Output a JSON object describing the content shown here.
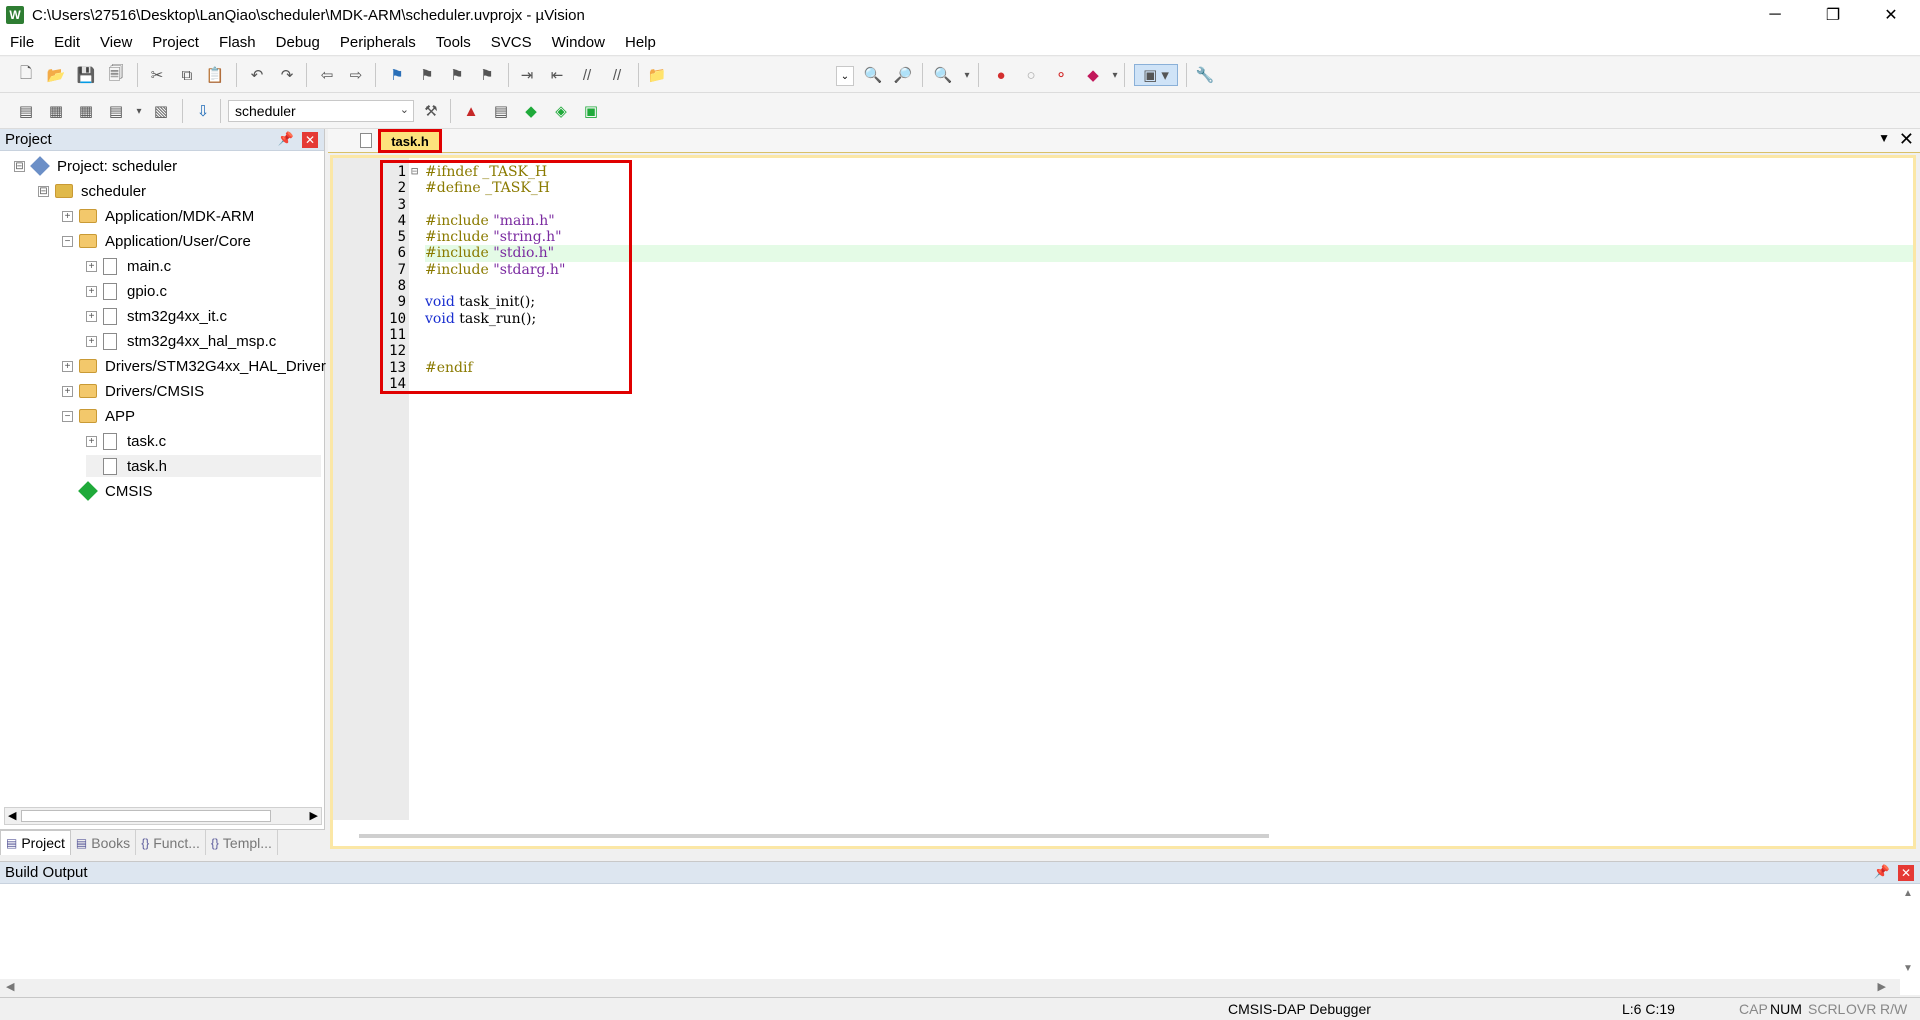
{
  "window": {
    "title": "C:\\Users\\27516\\Desktop\\LanQiao\\scheduler\\MDK-ARM\\scheduler.uvprojx - µVision",
    "app_icon": "W",
    "minimize_glyph": "─",
    "maximize_glyph": "❐",
    "close_glyph": "✕"
  },
  "menu": [
    "File",
    "Edit",
    "View",
    "Project",
    "Flash",
    "Debug",
    "Peripherals",
    "Tools",
    "SVCS",
    "Window",
    "Help"
  ],
  "toolbar": {
    "target_name": "scheduler",
    "icons": [
      "new-file",
      "open-file",
      "save",
      "save-all",
      "cut",
      "copy",
      "paste",
      "undo",
      "redo",
      "nav-back",
      "nav-forward",
      "bookmark",
      "bookmark-prev",
      "bookmark-next",
      "bookmark-clear",
      "indent",
      "unindent",
      "comment",
      "uncomment",
      "find-in-files",
      "find",
      "incremental-find",
      "debug-session",
      "breakpoint",
      "breakpoint-disable",
      "breakpoint-kill",
      "window-layout",
      "configure",
      "translate",
      "build",
      "rebuild",
      "batch-build",
      "stop-build",
      "download",
      "target-options",
      "manage-components",
      "manage-rte",
      "select-packs",
      "pack-installer"
    ]
  },
  "project_panel": {
    "title": "Project",
    "tree": [
      {
        "label": "Project: scheduler",
        "expander": "⊟",
        "kind": "project"
      },
      {
        "label": "scheduler",
        "expander": "⊟",
        "kind": "target"
      },
      {
        "label": "Application/MDK-ARM",
        "expander": "+",
        "kind": "folder"
      },
      {
        "label": "Application/User/Core",
        "expander": "−",
        "kind": "folder-open"
      },
      {
        "label": "main.c",
        "expander": "+",
        "kind": "file"
      },
      {
        "label": "gpio.c",
        "expander": "+",
        "kind": "file"
      },
      {
        "label": "stm32g4xx_it.c",
        "expander": "+",
        "kind": "file"
      },
      {
        "label": "stm32g4xx_hal_msp.c",
        "expander": "+",
        "kind": "file"
      },
      {
        "label": "Drivers/STM32G4xx_HAL_Driver",
        "expander": "+",
        "kind": "folder"
      },
      {
        "label": "Drivers/CMSIS",
        "expander": "+",
        "kind": "folder"
      },
      {
        "label": "APP",
        "expander": "−",
        "kind": "folder-open"
      },
      {
        "label": "task.c",
        "expander": "+",
        "kind": "file"
      },
      {
        "label": "task.h",
        "expander": "",
        "kind": "file",
        "selected": true
      },
      {
        "label": "CMSIS",
        "expander": "",
        "kind": "component"
      }
    ],
    "tabs": [
      {
        "label": "Project",
        "icon": "project-icon",
        "active": true
      },
      {
        "label": "Books",
        "icon": "books-icon"
      },
      {
        "label": "Funct...",
        "icon": "functions-icon",
        "glyph": "{}"
      },
      {
        "label": "Templ...",
        "icon": "templates-icon",
        "glyph": "{}"
      }
    ]
  },
  "editor": {
    "tab_label": "task.h",
    "line_numbers": [
      "1",
      "2",
      "3",
      "4",
      "5",
      "6",
      "7",
      "8",
      "9",
      "10",
      "11",
      "12",
      "13",
      "14"
    ],
    "current_line": 6,
    "lines": [
      [
        {
          "t": "#ifndef _TASK_H",
          "c": "pp"
        }
      ],
      [
        {
          "t": "#define _TASK_H",
          "c": "pp"
        }
      ],
      [],
      [
        {
          "t": "#include ",
          "c": "pp"
        },
        {
          "t": "\"main.h\"",
          "c": "str"
        }
      ],
      [
        {
          "t": "#include ",
          "c": "pp"
        },
        {
          "t": "\"string.h\"",
          "c": "str"
        }
      ],
      [
        {
          "t": "#include ",
          "c": "pp"
        },
        {
          "t": "\"stdio.h\"",
          "c": "str"
        }
      ],
      [
        {
          "t": "#include ",
          "c": "pp"
        },
        {
          "t": "\"stdarg.h\"",
          "c": "str"
        }
      ],
      [],
      [
        {
          "t": "void",
          "c": "kw"
        },
        {
          "t": " task_init();",
          "c": "pl"
        }
      ],
      [
        {
          "t": "void",
          "c": "kw"
        },
        {
          "t": " task_run();",
          "c": "pl"
        }
      ],
      [],
      [],
      [
        {
          "t": "#endif",
          "c": "pp"
        }
      ],
      []
    ]
  },
  "build_output": {
    "title": "Build Output"
  },
  "status": {
    "debugger": "CMSIS-DAP Debugger",
    "position": "L:6 C:19",
    "cap": "CAP",
    "num": "NUM",
    "scrl": "SCRL",
    "ovr": "OVR",
    "rw": "R/W"
  },
  "colors": {
    "active_tab_bg": "#fde27c",
    "highlight_box": "#e00000",
    "current_line_bg": "#e4fbe6",
    "preprocessor": "#8a7a00",
    "string": "#7a2aa0",
    "keyword": "#1a2fd0"
  }
}
